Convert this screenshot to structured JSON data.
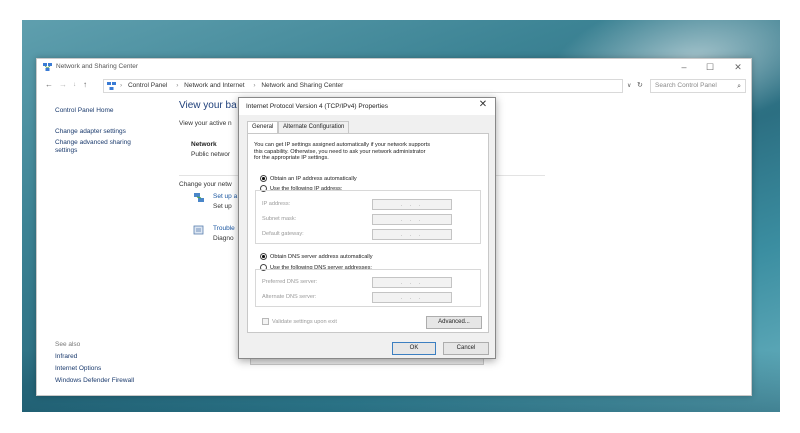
{
  "window": {
    "title": "Network and Sharing Center",
    "controls": [
      "–",
      "☐",
      "✕"
    ]
  },
  "address_bar": {
    "nav": [
      "←",
      "→",
      "↓",
      "↑"
    ],
    "crumbs": [
      "Control Panel",
      "Network and Internet",
      "Network and Sharing Center"
    ],
    "search_placeholder": "Search Control Panel"
  },
  "sidebar": {
    "items": [
      "Control Panel Home",
      "Change adapter settings",
      "Change advanced sharing",
      "settings"
    ],
    "see_also_heading": "See also",
    "see_also": [
      "Infrared",
      "Internet Options",
      "Windows Defender Firewall"
    ]
  },
  "main": {
    "title": "View your ba",
    "active_networks": "View your active n",
    "network_name": "Network",
    "network_type": "Public networ",
    "change_heading": "Change your netw",
    "task1_link": "Set up a",
    "task1_desc": "Set up",
    "task2_link": "Trouble",
    "task2_desc": "Diagno"
  },
  "dialog": {
    "title": "Internet Protocol Version 4 (TCP/IPv4) Properties",
    "close": "✕",
    "tabs": [
      "General",
      "Alternate Configuration"
    ],
    "description_lines": [
      "You can get IP settings assigned automatically if your network supports",
      "this capability. Otherwise, you need to ask your network administrator",
      "for the appropriate IP settings."
    ],
    "ip_auto_label": "Obtain an IP address automatically",
    "ip_manual_label": "Use the following IP address:",
    "ip_fields": [
      "IP address:",
      "Subnet mask:",
      "Default gateway:"
    ],
    "dns_auto_label": "Obtain DNS server address automatically",
    "dns_manual_label": "Use the following DNS server addresses:",
    "dns_fields": [
      "Preferred DNS server:",
      "Alternate DNS server:"
    ],
    "ip_placeholder": ". . .",
    "validate_label": "Validate settings upon exit",
    "advanced_label": "Advanced...",
    "ok_label": "OK",
    "cancel_label": "Cancel"
  }
}
